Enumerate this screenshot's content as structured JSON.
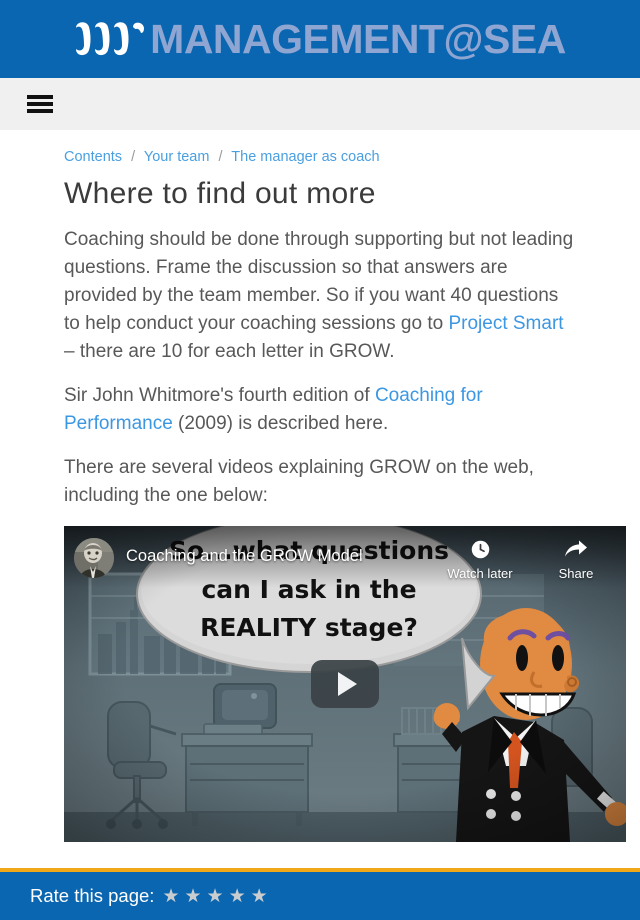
{
  "header": {
    "brand_text": "MANAGEMENT@SEA",
    "logo_icon": "triple-wave-logo-icon",
    "brand_bg": "#0a66b0",
    "brand_text_color": "#8fa6d2"
  },
  "navbar": {
    "menu_icon": "hamburger-menu-icon",
    "bg": "#f0f0f0"
  },
  "breadcrumb": {
    "separator": "/",
    "items": [
      {
        "label": "Contents"
      },
      {
        "label": "Your team"
      },
      {
        "label": "The manager as coach"
      }
    ]
  },
  "main": {
    "title": "Where to find out more",
    "paragraphs": [
      {
        "segments": [
          {
            "type": "text",
            "text": "Coaching should be done through supporting but not leading questions. Frame the discussion so that answers are provided by the team member. So if you want 40 questions to help conduct your coaching sessions go to "
          },
          {
            "type": "link",
            "text": "Project Smart"
          },
          {
            "type": "text",
            "text": " – there are 10 for each letter in GROW."
          }
        ]
      },
      {
        "segments": [
          {
            "type": "text",
            "text": "Sir John Whitmore's fourth edition of "
          },
          {
            "type": "link",
            "text": "Coaching for Performance"
          },
          {
            "type": "text",
            "text": " (2009) is described here."
          }
        ]
      },
      {
        "segments": [
          {
            "type": "text",
            "text": "There are several videos explaining GROW on the web, including the one below:"
          }
        ]
      }
    ]
  },
  "video": {
    "title": "Coaching and the GROW Model",
    "avatar_icon": "channel-avatar",
    "play_icon": "play-button-icon",
    "actions": [
      {
        "label": "Watch later",
        "icon": "clock-icon"
      },
      {
        "label": "Share",
        "icon": "share-arrow-icon"
      }
    ],
    "thumbnail_speech_lines": [
      "So...what questions",
      "can I ask in the",
      "REALITY stage?"
    ]
  },
  "rating": {
    "label": "Rate this page:",
    "star_glyph": "★",
    "star_count": 5,
    "filled": 0,
    "star_color": "#c9cdd0",
    "bar_bg": "#0a66b0",
    "divider_color": "#f0a819"
  }
}
